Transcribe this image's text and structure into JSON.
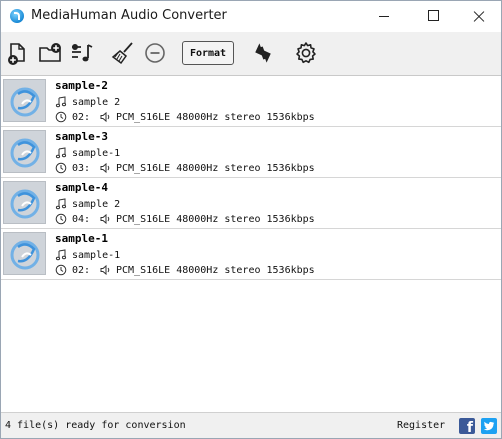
{
  "window": {
    "title": "MediaHuman Audio Converter"
  },
  "toolbar": {
    "format_label": "Format",
    "icons": [
      "add-file-icon",
      "add-folder-icon",
      "add-itunes-playlist-icon",
      "clear-list-icon",
      "remove-item-icon",
      "convert-icon",
      "settings-icon"
    ]
  },
  "files": [
    {
      "name": "sample-2",
      "artist": "sample 2",
      "duration": "02:",
      "details": "PCM_S16LE 48000Hz stereo 1536kbps"
    },
    {
      "name": "sample-3",
      "artist": "sample-1",
      "duration": "03:",
      "details": "PCM_S16LE 48000Hz stereo 1536kbps"
    },
    {
      "name": "sample-4",
      "artist": "sample 2",
      "duration": "04:",
      "details": "PCM_S16LE 48000Hz stereo 1536kbps"
    },
    {
      "name": "sample-1",
      "artist": "sample-1",
      "duration": "02:",
      "details": "PCM_S16LE 48000Hz stereo 1536kbps"
    }
  ],
  "statusbar": {
    "status": "4 file(s) ready for conversion",
    "register": "Register",
    "facebook": "f"
  },
  "colors": {
    "facebook": "#3b5998",
    "twitter": "#1da1f2",
    "toolbar_bg": "#f0f0f0"
  }
}
